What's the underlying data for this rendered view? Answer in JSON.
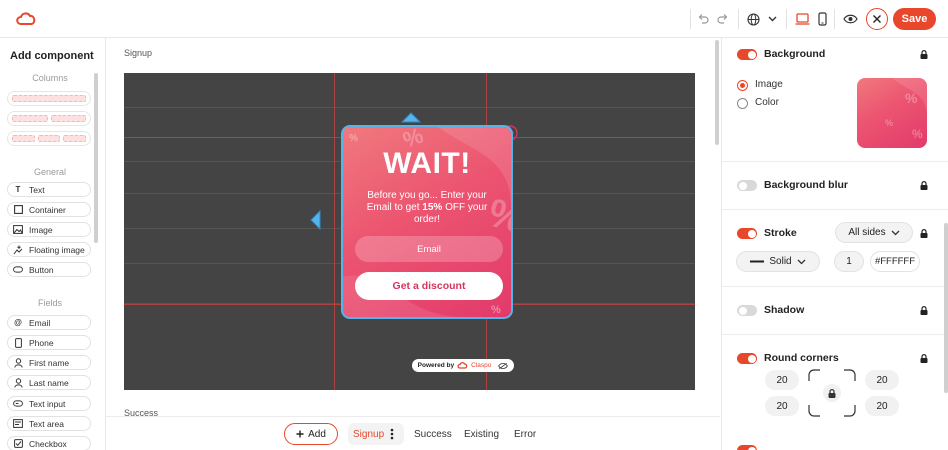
{
  "topbar": {
    "save_label": "Save"
  },
  "left_panel": {
    "title": "Add component",
    "sections": {
      "columns": "Columns",
      "general": "General",
      "fields": "Fields"
    },
    "general_items": [
      "Text",
      "Container",
      "Image",
      "Floating image",
      "Button"
    ],
    "field_items": [
      "Email",
      "Phone",
      "First name",
      "Last name",
      "Text input",
      "Text area",
      "Checkbox"
    ]
  },
  "canvas": {
    "signup_label": "Signup",
    "success_label": "Success",
    "popup": {
      "title": "WAIT!",
      "text_before": "Before you go... Enter your Email to get ",
      "text_highlight": "15%",
      "text_after": " OFF your order!",
      "email_placeholder": "Email",
      "cta_label": "Get a discount"
    },
    "powered_by": {
      "label": "Powered by",
      "brand": "Claspo"
    }
  },
  "bottom_bar": {
    "add_label": "Add",
    "tabs": [
      "Signup",
      "Success",
      "Existing",
      "Error"
    ],
    "active_tab": "Signup"
  },
  "right_panel": {
    "background": {
      "label": "Background",
      "enabled": true,
      "options": [
        "Image",
        "Color"
      ],
      "selected": "Image"
    },
    "background_blur": {
      "label": "Background blur",
      "enabled": false
    },
    "stroke": {
      "label": "Stroke",
      "enabled": true,
      "sides": "All sides",
      "style": "Solid",
      "width": "1",
      "color": "#FFFFFF"
    },
    "shadow": {
      "label": "Shadow",
      "enabled": false
    },
    "round_corners": {
      "label": "Round corners",
      "enabled": true,
      "values": [
        "20",
        "20",
        "20",
        "20"
      ]
    }
  },
  "colors": {
    "accent": "#e8472b",
    "selection": "#56b4ea",
    "popup_gradient_start": "#f0797e",
    "popup_gradient_end": "#e23a6b",
    "stage_bg": "#444444"
  }
}
